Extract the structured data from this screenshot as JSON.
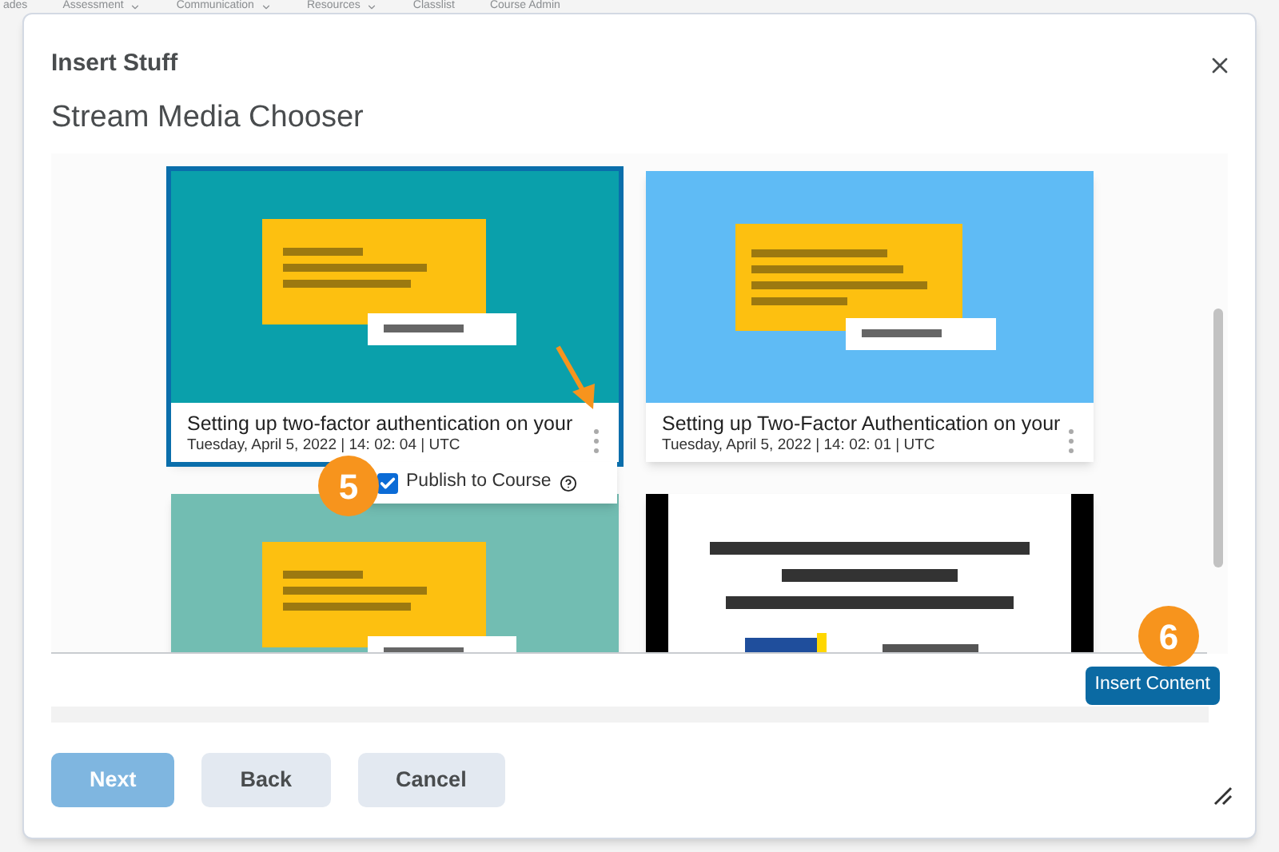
{
  "background_nav": [
    "ades",
    "Assessment",
    "Communication",
    "Resources",
    "Classlist",
    "Course Admin"
  ],
  "dialog": {
    "title": "Insert Stuff",
    "subtitle": "Stream Media Chooser"
  },
  "cards": [
    {
      "selected": true,
      "title": "Setting up two-factor authentication on your",
      "date": "Tuesday, April 5, 2022 | 14: 02: 04 | UTC"
    },
    {
      "selected": false,
      "title": "Setting up Two-Factor Authentication on your",
      "date": "Tuesday, April 5, 2022 | 14: 02: 01 | UTC"
    },
    {
      "selected": false
    },
    {
      "selected": false
    }
  ],
  "publish_option": {
    "label": "Publish to Course",
    "checked": true
  },
  "step_markers": [
    "5",
    "6"
  ],
  "insert_button": {
    "label": "Insert Content"
  },
  "buttons": [
    {
      "label": "Next",
      "kind": "primary",
      "disabled": true
    },
    {
      "label": "Back",
      "kind": "secondary",
      "disabled": false
    },
    {
      "label": "Cancel",
      "kind": "secondary",
      "disabled": false
    }
  ]
}
